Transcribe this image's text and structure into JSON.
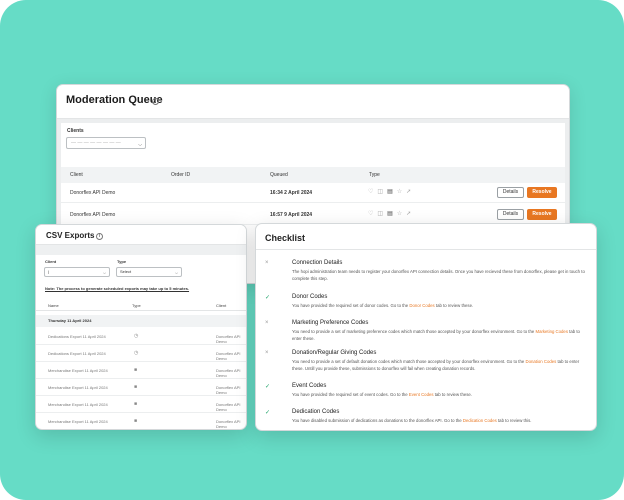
{
  "moderation": {
    "title": "Moderation Queue",
    "client_label": "Clients",
    "client_placeholder": "— — — — — — — —",
    "columns": [
      "Client",
      "Order ID",
      "Queued",
      "Type"
    ],
    "rows": [
      {
        "client": "Donorflex API Demo",
        "order_id": "",
        "queued": "16:34 2 April 2024",
        "details": "Details",
        "resolve": "Resolve"
      },
      {
        "client": "Donorflex API Demo",
        "order_id": "",
        "queued": "16:57 9 April 2024",
        "details": "Details",
        "resolve": "Resolve"
      }
    ]
  },
  "csv": {
    "title": "CSV Exports",
    "client_label": "Client",
    "client_value": "|",
    "type_label": "Type",
    "type_value": "Select",
    "note": "Note: The process to generate scheduled exports may take up to 5 minutes.",
    "columns": [
      "Name",
      "Type",
      "Client"
    ],
    "date_group": "Thursday 11 April 2024",
    "rows": [
      {
        "name": "Dedications Export 11 April 2024",
        "type_icon": "clock-icon",
        "client": "Donorflex API Demo"
      },
      {
        "name": "Dedications Export 11 April 2024",
        "type_icon": "clock-icon",
        "client": "Donorflex API Demo"
      },
      {
        "name": "Merchandise Export 11 April 2024",
        "type_icon": "bag-icon",
        "client": "Donorflex API Demo"
      },
      {
        "name": "Merchandise Export 11 April 2024",
        "type_icon": "bag-icon",
        "client": "Donorflex API Demo"
      },
      {
        "name": "Merchandise Export 11 April 2024",
        "type_icon": "bag-icon",
        "client": "Donorflex API Demo"
      },
      {
        "name": "Merchandise Export 11 April 2024",
        "type_icon": "bag-icon",
        "client": "Donorflex API Demo"
      }
    ]
  },
  "checklist": {
    "title": "Checklist",
    "items": [
      {
        "status": "incomplete",
        "name": "Connection Details",
        "desc_pre": "The hopi administration team needs to register your donorflex API connection details. Once you have recieved these from donorflex, please get in touch to complete this step.",
        "link": "",
        "desc_post": ""
      },
      {
        "status": "complete",
        "name": "Donor Codes",
        "desc_pre": "You have provided the required set of donor codes. Go to the ",
        "link": "Donor Codes",
        "desc_post": " tab to review these."
      },
      {
        "status": "incomplete",
        "name": "Marketing Preference Codes",
        "desc_pre": "You need to provide a set of marketing preference codes which match those accepted by your donorflex environment. Go to the ",
        "link": "Marketing Codes",
        "desc_post": " tab to enter these."
      },
      {
        "status": "incomplete",
        "name": "Donation/Regular Giving Codes",
        "desc_pre": "You need to provide a set of default donation codes which match those accepted by your donorflex environment. Go to the ",
        "link": "Donation Codes",
        "desc_post": " tab to enter these. Untill you provide these, submissions to donorflex will fail when creating donation records."
      },
      {
        "status": "complete",
        "name": "Event Codes",
        "desc_pre": "You have provided the required set of event codes. Go to the ",
        "link": "Event Codes",
        "desc_post": " tab to review these."
      },
      {
        "status": "complete",
        "name": "Dedication Codes",
        "desc_pre": "You have disabled submission of dedications as donations to the donorflex API. Go to the ",
        "link": "Dedication Codes",
        "desc_post": " tab to review this."
      }
    ]
  },
  "colors": {
    "background": "#66dcc6",
    "accent": "#e87722",
    "complete": "#22a56b"
  }
}
